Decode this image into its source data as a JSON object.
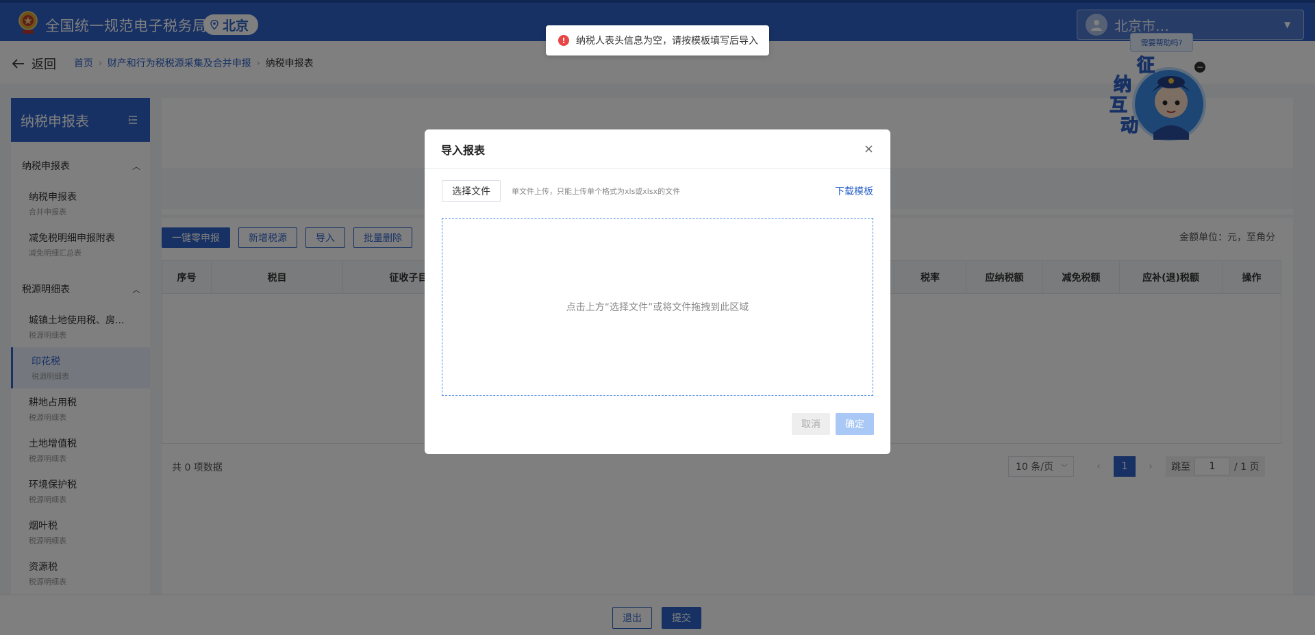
{
  "header": {
    "brand": "全国统一规范电子税务局",
    "city": "北京",
    "user_name": "北京市…"
  },
  "breadcrumb": {
    "back_label": "返回",
    "items": [
      "首页",
      "财产和行为税税源采集及合并申报",
      "纳税申报表"
    ]
  },
  "sidebar": {
    "title": "纳税申报表",
    "groups": [
      {
        "label": "纳税申报表",
        "items": [
          {
            "title": "纳税申报表",
            "sub": "合并申报表"
          },
          {
            "title": "减免税明细申报附表",
            "sub": "减免明细汇总表"
          }
        ]
      },
      {
        "label": "税源明细表",
        "items": [
          {
            "title": "城镇土地使用税、房...",
            "sub": "税源明细表"
          },
          {
            "title": "印花税",
            "sub": "税源明细表"
          },
          {
            "title": "耕地占用税",
            "sub": "税源明细表"
          },
          {
            "title": "土地增值税",
            "sub": "税源明细表"
          },
          {
            "title": "环境保护税",
            "sub": "税源明细表"
          },
          {
            "title": "烟叶税",
            "sub": "税源明细表"
          },
          {
            "title": "资源税",
            "sub": "税源明细表"
          }
        ]
      }
    ]
  },
  "toolbar": {
    "zero_declare": "一键零申报",
    "add_source": "新增税源",
    "import": "导入",
    "batch_delete": "批量删除",
    "unit_note": "金额单位：元，至角分"
  },
  "table": {
    "headers": [
      "序号",
      "税目",
      "征收子目",
      "",
      "税率",
      "应纳税额",
      "减免税额",
      "应补(退)税额",
      "操作"
    ]
  },
  "pagination": {
    "total": "共 0 项数据",
    "page_size": "10 条/页",
    "current": "1",
    "jump_label": "跳至",
    "jump_value": "1",
    "pages_suffix": "/ 1 页"
  },
  "bottom": {
    "exit": "退出",
    "submit": "提交"
  },
  "helper": {
    "bubble": "需要帮助吗?",
    "chars": [
      "征",
      "纳",
      "互",
      "动"
    ]
  },
  "modal": {
    "title": "导入报表",
    "choose_file": "选择文件",
    "file_hint": "单文件上传，只能上传单个格式为xls或xlsx的文件",
    "download_template": "下载模板",
    "drop_text": "点击上方“选择文件”或将文件拖拽到此区域",
    "cancel": "取消",
    "confirm": "确定"
  },
  "toast": {
    "message": "纳税人表头信息为空，请按模板填写后导入"
  },
  "colors": {
    "primary": "#2f63c9",
    "error": "#e84545"
  }
}
